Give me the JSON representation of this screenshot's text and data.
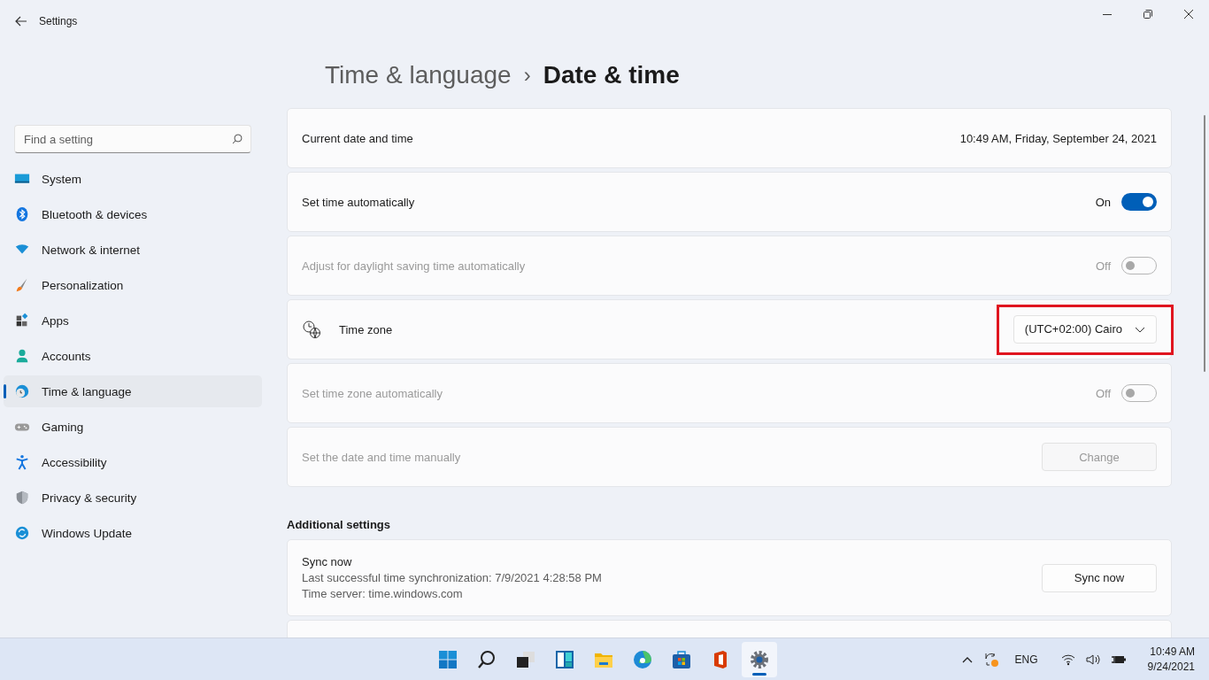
{
  "window": {
    "title": "Settings"
  },
  "sidebar": {
    "search": {
      "placeholder": "Find a setting"
    },
    "items": [
      {
        "label": "System",
        "selected": false
      },
      {
        "label": "Bluetooth & devices",
        "selected": false
      },
      {
        "label": "Network & internet",
        "selected": false
      },
      {
        "label": "Personalization",
        "selected": false
      },
      {
        "label": "Apps",
        "selected": false
      },
      {
        "label": "Accounts",
        "selected": false
      },
      {
        "label": "Time & language",
        "selected": true
      },
      {
        "label": "Gaming",
        "selected": false
      },
      {
        "label": "Accessibility",
        "selected": false
      },
      {
        "label": "Privacy & security",
        "selected": false
      },
      {
        "label": "Windows Update",
        "selected": false
      }
    ]
  },
  "breadcrumb": {
    "parent": "Time & language",
    "separator": "›",
    "current": "Date & time"
  },
  "settings": [
    {
      "kind": "value",
      "label": "Current date and time",
      "value": "10:49 AM, Friday, September 24, 2021",
      "disabled": false
    },
    {
      "kind": "toggle",
      "label": "Set time automatically",
      "state_label": "On",
      "on": true,
      "disabled": false
    },
    {
      "kind": "toggle",
      "label": "Adjust for daylight saving time automatically",
      "state_label": "Off",
      "on": false,
      "disabled": true
    },
    {
      "kind": "dropdown",
      "label": "Time zone",
      "value": "(UTC+02:00) Cairo",
      "highlighted": true,
      "disabled": false
    },
    {
      "kind": "toggle",
      "label": "Set time zone automatically",
      "state_label": "Off",
      "on": false,
      "disabled": true
    },
    {
      "kind": "button",
      "label": "Set the date and time manually",
      "button": "Change",
      "disabled": true
    }
  ],
  "additional": {
    "heading": "Additional settings",
    "sync": {
      "title": "Sync now",
      "lines": [
        "Last successful time synchronization: 7/9/2021 4:28:58 PM",
        "Time server: time.windows.com"
      ],
      "button": "Sync now"
    }
  },
  "taskbar": {
    "apps": [
      {
        "selected": false
      },
      {
        "selected": false
      },
      {
        "selected": false
      },
      {
        "selected": false
      },
      {
        "selected": false
      },
      {
        "selected": false
      },
      {
        "selected": false
      },
      {
        "selected": false
      },
      {
        "selected": true
      }
    ],
    "language": "ENG",
    "time": "10:49 AM",
    "date": "9/24/2021"
  }
}
